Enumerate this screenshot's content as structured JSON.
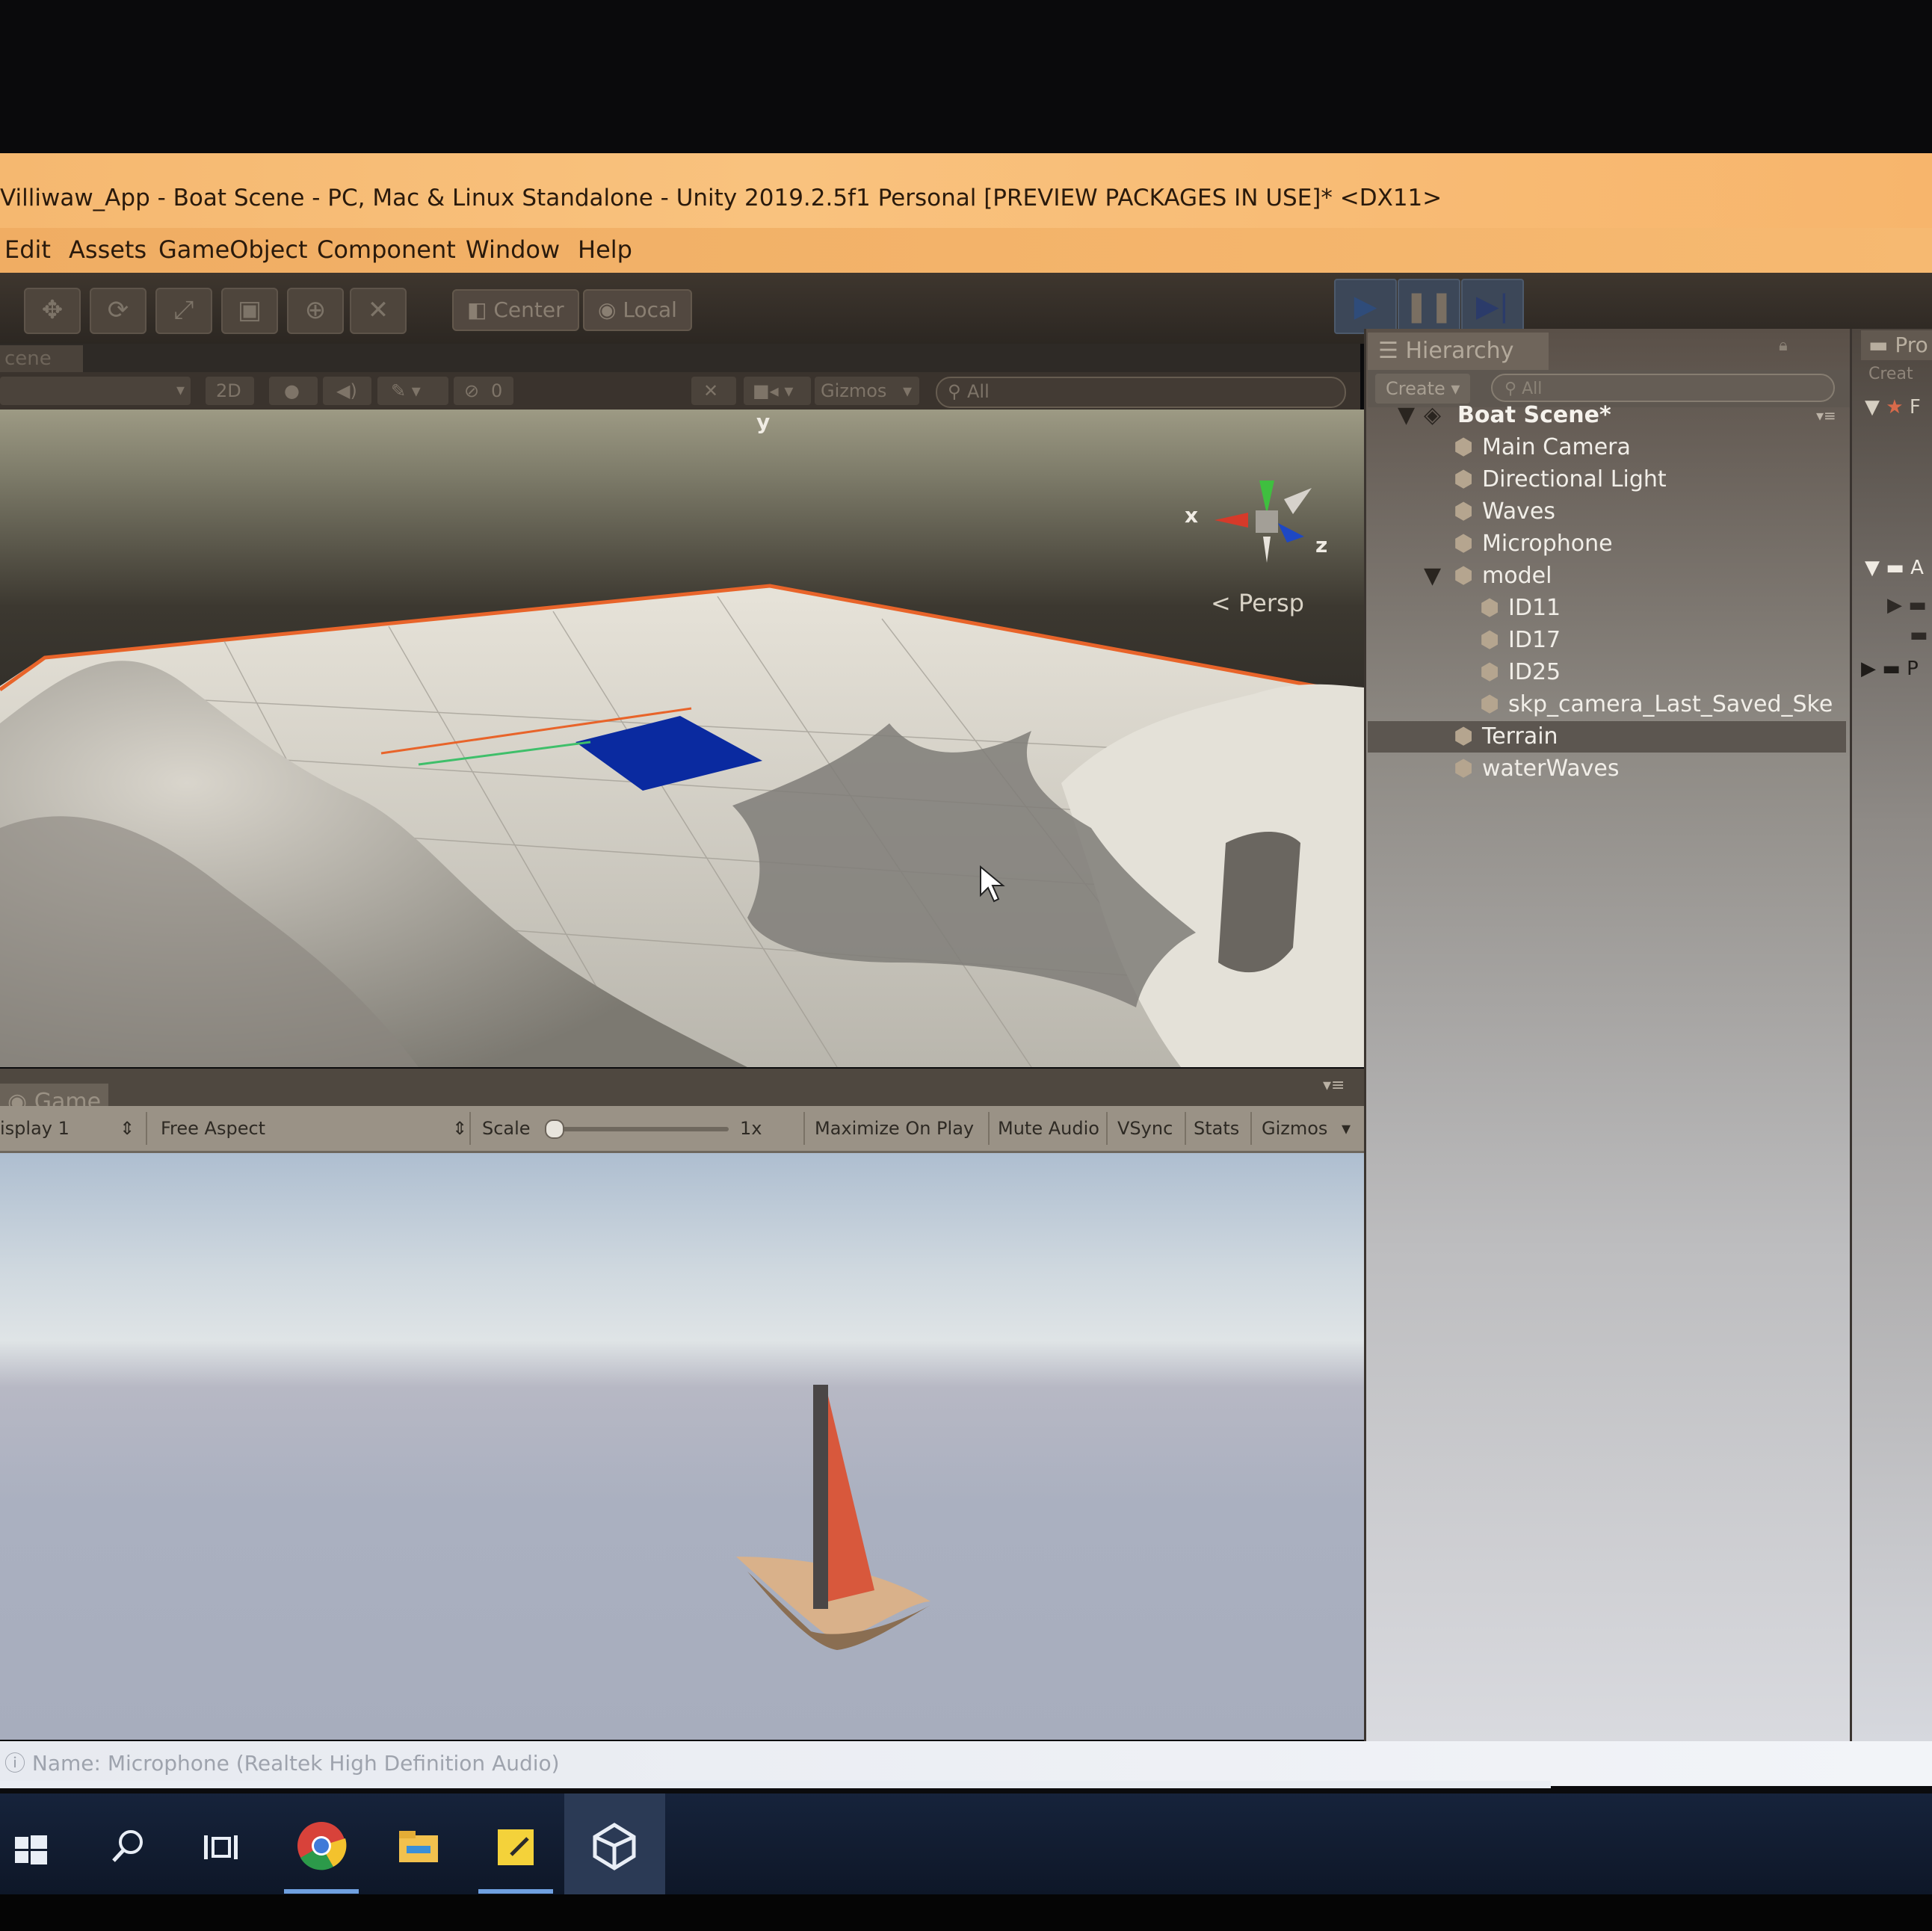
{
  "window": {
    "title": "Villiwaw_App - Boat Scene - PC, Mac & Linux Standalone - Unity 2019.2.5f1 Personal [PREVIEW PACKAGES IN USE]* <DX11>"
  },
  "menu": [
    "Edit",
    "Assets",
    "GameObject",
    "Component",
    "Window",
    "Help"
  ],
  "toolbar": {
    "pivot_label": "Center",
    "space_label": "Local"
  },
  "scene": {
    "tab_label": "cene",
    "mode_label": "2D",
    "hidden_count": "0",
    "gizmos_label": "Gizmos",
    "search_placeholder": "All",
    "persp_label": "< Persp",
    "axis_x": "x",
    "axis_y": "y",
    "axis_z": "z"
  },
  "game": {
    "tab_label": "Game",
    "display_label": "isplay 1",
    "aspect_label": "Free Aspect",
    "scale_label": "Scale",
    "scale_value": "1x",
    "scale_level": 0,
    "maximize_label": "Maximize On Play",
    "mute_label": "Mute Audio",
    "vsync_label": "VSync",
    "stats_label": "Stats",
    "gizmos_label": "Gizmos"
  },
  "hierarchy": {
    "tab_label": "Hierarchy",
    "create_label": "Create",
    "search_placeholder": "All",
    "scene_name": "Boat Scene*",
    "items": [
      {
        "label": "Main Camera",
        "depth": 1
      },
      {
        "label": "Directional Light",
        "depth": 1
      },
      {
        "label": "Waves",
        "depth": 1
      },
      {
        "label": "Microphone",
        "depth": 1
      },
      {
        "label": "model",
        "depth": 1
      },
      {
        "label": "ID11",
        "depth": 2
      },
      {
        "label": "ID17",
        "depth": 2
      },
      {
        "label": "ID25",
        "depth": 2
      },
      {
        "label": "skp_camera_Last_Saved_Ske",
        "depth": 2
      },
      {
        "label": "Terrain",
        "depth": 1,
        "selected": true
      },
      {
        "label": "waterWaves",
        "depth": 1
      }
    ]
  },
  "project": {
    "tab_label": "Pro",
    "create_label": "Creat",
    "letter_a": "A",
    "letter_f": "F",
    "letter_p": "P"
  },
  "status": {
    "text": "Name: Microphone (Realtek High Definition Audio)"
  },
  "taskbar": {
    "icons": [
      "windows-start-icon",
      "search-icon",
      "task-view-icon",
      "chrome-icon",
      "file-explorer-icon",
      "sticky-notes-icon",
      "unity-icon"
    ]
  },
  "colors": {
    "title_bar": "#f7b56c",
    "selection_blue": "#0a2aa0",
    "terrain_outline": "#e8642a",
    "sail": "#d8583c",
    "hull": "#d9b18a"
  }
}
